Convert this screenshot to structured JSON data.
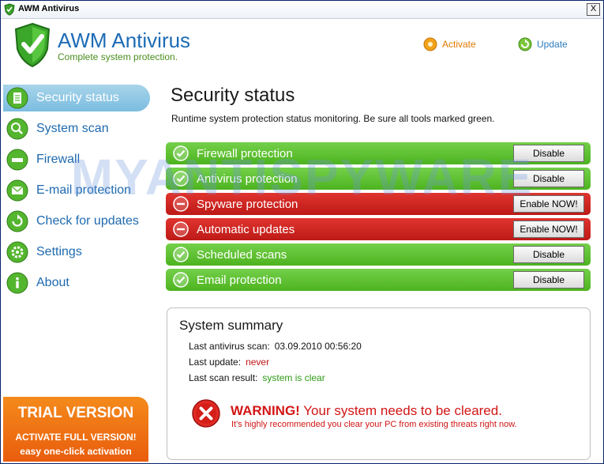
{
  "window": {
    "title": "AWM Antivirus",
    "close_label": "X"
  },
  "header": {
    "app_name": "AWM Antivirus",
    "tagline": "Complete system protection.",
    "activate_label": "Activate",
    "update_label": "Update"
  },
  "sidebar": {
    "items": [
      {
        "label": "Security status",
        "icon": "document-icon",
        "active": true
      },
      {
        "label": "System scan",
        "icon": "magnifier-icon",
        "active": false
      },
      {
        "label": "Firewall",
        "icon": "firewall-icon",
        "active": false
      },
      {
        "label": "E-mail protection",
        "icon": "envelope-icon",
        "active": false
      },
      {
        "label": "Check for updates",
        "icon": "refresh-icon",
        "active": false
      },
      {
        "label": "Settings",
        "icon": "gear-icon",
        "active": false
      },
      {
        "label": "About",
        "icon": "info-icon",
        "active": false
      }
    ]
  },
  "trial": {
    "title": "TRIAL VERSION",
    "line1": "ACTIVATE FULL VERSION!",
    "line2": "easy one-click activation"
  },
  "main": {
    "title": "Security status",
    "subtitle": "Runtime system protection status monitoring. Be sure all tools marked green."
  },
  "protections": [
    {
      "label": "Firewall protection",
      "status": "ok",
      "button": "Disable"
    },
    {
      "label": "Antivirus protection",
      "status": "ok",
      "button": "Disable"
    },
    {
      "label": "Spyware protection",
      "status": "off",
      "button": "Enable NOW!"
    },
    {
      "label": "Automatic updates",
      "status": "off",
      "button": "Enable NOW!"
    },
    {
      "label": "Scheduled scans",
      "status": "ok",
      "button": "Disable"
    },
    {
      "label": "Email protection",
      "status": "ok",
      "button": "Disable"
    }
  ],
  "summary": {
    "title": "System summary",
    "last_scan_label": "Last antivirus scan:",
    "last_scan_value": "03.09.2010 00:56:20",
    "last_update_label": "Last update:",
    "last_update_value": "never",
    "last_result_label": "Last scan result:",
    "last_result_value": "system is clear",
    "warning_title": "WARNING!",
    "warning_text": "Your system needs to be cleared.",
    "warning_sub": "It's highly recommended you clear your PC from existing threats right now."
  },
  "watermark": "MYANTISPYWARE",
  "colors": {
    "brand_blue": "#1d6bb5",
    "ok_green": "#4db31f",
    "alert_red": "#bd1a17",
    "trial_orange": "#e95d0d"
  }
}
